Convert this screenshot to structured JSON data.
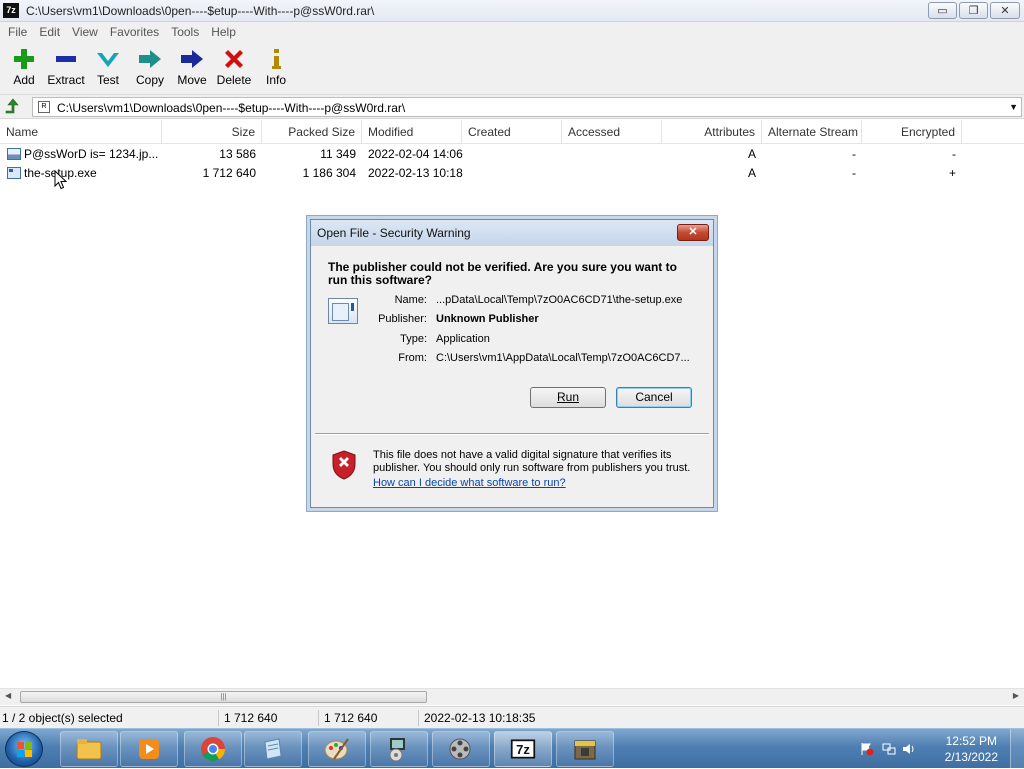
{
  "window": {
    "title": "C:\\Users\\vm1\\Downloads\\0pen----$etup----With----p@ssW0rd.rar\\",
    "app_icon": "7z",
    "controls": {
      "minimize": "▭",
      "restore": "❐",
      "close": "✕"
    }
  },
  "menu": [
    "File",
    "Edit",
    "View",
    "Favorites",
    "Tools",
    "Help"
  ],
  "toolbar": [
    {
      "label": "Add",
      "icon": "plus-icon",
      "color": "#1a9a1a"
    },
    {
      "label": "Extract",
      "icon": "minus-icon",
      "color": "#1c2fa8"
    },
    {
      "label": "Test",
      "icon": "check-icon",
      "color": "#17a3b8"
    },
    {
      "label": "Copy",
      "icon": "arrow-right-icon",
      "color": "#1f8f8a"
    },
    {
      "label": "Move",
      "icon": "arrow-right-icon",
      "color": "#1a2a9a"
    },
    {
      "label": "Delete",
      "icon": "x-icon",
      "color": "#d01010"
    },
    {
      "label": "Info",
      "icon": "info-icon",
      "color": "#b08a00"
    }
  ],
  "address": {
    "path": "C:\\Users\\vm1\\Downloads\\0pen----$etup----With----p@ssW0rd.rar\\"
  },
  "columns": [
    "Name",
    "Size",
    "Packed Size",
    "Modified",
    "Created",
    "Accessed",
    "Attributes",
    "Alternate Stream",
    "Encrypted"
  ],
  "files": [
    {
      "name": "P@ssWorD is=   1234.jp...",
      "size": "13 586",
      "packed": "11 349",
      "modified": "2022-02-04 14:06",
      "created": "",
      "accessed": "",
      "attributes": "A",
      "alt_stream": "-",
      "encrypted": "-",
      "icon": "image-file-icon"
    },
    {
      "name": "the-setup.exe",
      "size": "1 712 640",
      "packed": "1 186 304",
      "modified": "2022-02-13 10:18",
      "created": "",
      "accessed": "",
      "attributes": "A",
      "alt_stream": "-",
      "encrypted": "+",
      "icon": "exe-file-icon"
    }
  ],
  "status": {
    "selected": "1 / 2 object(s) selected",
    "size": "1 712 640",
    "packed": "1 712 640",
    "modified": "2022-02-13 10:18:35"
  },
  "dialog": {
    "title": "Open File - Security Warning",
    "close": "✕",
    "question": "The publisher could not be verified.  Are you sure you want to run this software?",
    "name_label": "Name:",
    "name_value": "...pData\\Local\\Temp\\7zO0AC6CD71\\the-setup.exe",
    "publisher_label": "Publisher:",
    "publisher_value": "Unknown Publisher",
    "type_label": "Type:",
    "type_value": "Application",
    "from_label": "From:",
    "from_value": "C:\\Users\\vm1\\AppData\\Local\\Temp\\7zO0AC6CD7...",
    "run_label": "Run",
    "cancel_label": "Cancel",
    "warning_text": "This file does not have a valid digital signature that verifies its publisher.  You should only run software from publishers you trust.",
    "help_link": "How can I decide what software to run?"
  },
  "taskbar": {
    "apps": [
      "file-explorer-icon",
      "media-player-icon",
      "chrome-icon",
      "notepad-icon",
      "paint-icon",
      "installer-icon",
      "video-editor-icon",
      "7zip-icon",
      "archive-tool-icon"
    ],
    "active_app": "7zip-icon",
    "clock_time": "12:52 PM",
    "clock_date": "2/13/2022"
  }
}
